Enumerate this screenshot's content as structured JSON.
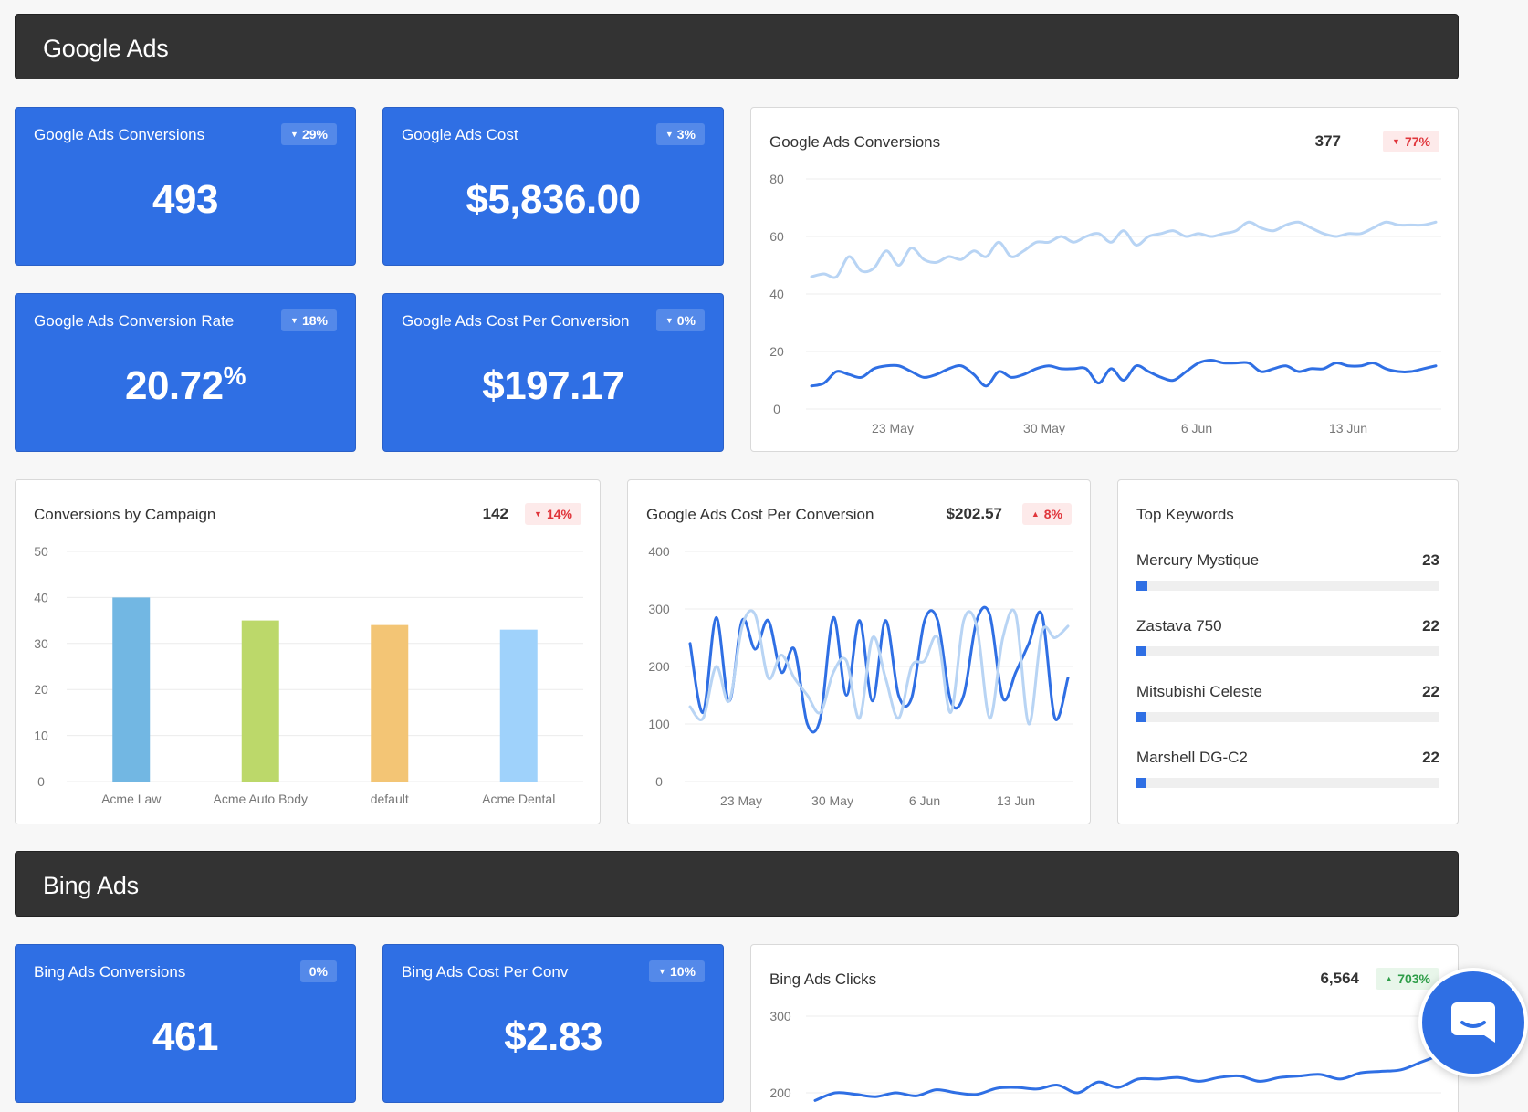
{
  "google_section": {
    "title": "Google Ads"
  },
  "bing_section": {
    "title": "Bing Ads"
  },
  "kpis": {
    "g_conversions": {
      "title": "Google Ads Conversions",
      "badge": "29%",
      "value": "493"
    },
    "g_cost": {
      "title": "Google Ads Cost",
      "badge": "3%",
      "value": "$5,836.00"
    },
    "g_conv_rate": {
      "title": "Google Ads Conversion Rate",
      "badge": "18%",
      "value": "20.72",
      "unit": "%"
    },
    "g_cost_per_conv": {
      "title": "Google Ads Cost Per Conversion",
      "badge": "0%",
      "value": "$197.17"
    },
    "b_conversions": {
      "title": "Bing Ads Conversions",
      "badge": "0%",
      "value": "461"
    },
    "b_cost_per_conv": {
      "title": "Bing Ads Cost Per Conv",
      "badge": "10%",
      "value": "$2.83"
    }
  },
  "cards": {
    "g_conv_chart": {
      "title": "Google Ads Conversions",
      "total": "377",
      "delta": "77%"
    },
    "campaign_chart": {
      "title": "Conversions by Campaign",
      "total": "142",
      "delta": "14%"
    },
    "cpc_chart": {
      "title": "Google Ads Cost Per Conversion",
      "total": "$202.57",
      "delta": "8%"
    },
    "keywords": {
      "title": "Top Keywords"
    },
    "bing_clicks": {
      "title": "Bing Ads Clicks",
      "total": "6,564",
      "delta": "703%"
    }
  },
  "keywords": [
    {
      "name": "Mercury Mystique",
      "count": "23",
      "fill": 0.035
    },
    {
      "name": "Zastava 750",
      "count": "22",
      "fill": 0.034
    },
    {
      "name": "Mitsubishi Celeste",
      "count": "22",
      "fill": 0.034
    },
    {
      "name": "Marshell DG-C2",
      "count": "22",
      "fill": 0.034
    }
  ],
  "colors": {
    "kpi_blue": "#2f6fe4",
    "series_dark": "#2f6fe4",
    "series_light": "#b8d4f4",
    "bar_colors": [
      "#72b7e3",
      "#bcd86a",
      "#f3c575",
      "#9fd2fb"
    ],
    "negative": "#e0353b",
    "positive": "#2e9d48"
  },
  "icons": {
    "badge_down": "triangle-down-icon",
    "badge_up": "triangle-up-icon",
    "chat": "chat-bubble-icon"
  },
  "tri_down": "▼",
  "tri_up": "▲",
  "chart_data": [
    {
      "id": "google_conversions",
      "type": "line",
      "x_ticks": [
        "23 May",
        "30 May",
        "6 Jun",
        "13 Jun"
      ],
      "y_ticks": [
        "0",
        "20",
        "40",
        "60",
        "80"
      ],
      "ylim": [
        0,
        80
      ],
      "series": [
        {
          "values": [
            46,
            47,
            46,
            53,
            48,
            49,
            55,
            50,
            56,
            52,
            51,
            53,
            52,
            55,
            53,
            58,
            53,
            55,
            58,
            58,
            60,
            58,
            60,
            61,
            58,
            62,
            57,
            60,
            61,
            62,
            60,
            61,
            60,
            61,
            62,
            65,
            63,
            62,
            64,
            65,
            63,
            61,
            60,
            61,
            61,
            63,
            65,
            64,
            64,
            64,
            65
          ]
        },
        {
          "values": [
            8,
            9,
            13,
            12,
            11,
            14,
            15,
            15,
            13,
            11,
            12,
            14,
            15,
            12,
            8,
            13,
            11,
            12,
            14,
            15,
            14,
            14,
            14,
            9,
            14,
            10,
            15,
            13,
            11,
            10,
            13,
            16,
            17,
            16,
            16,
            16,
            13,
            14,
            15,
            13,
            14,
            14,
            16,
            15,
            15,
            16,
            14,
            13,
            13,
            14,
            15
          ]
        }
      ]
    },
    {
      "id": "conversions_by_campaign",
      "type": "bar",
      "categories": [
        "Acme Law",
        "Acme Auto Body",
        "default",
        "Acme Dental"
      ],
      "values": [
        40,
        35,
        34,
        33
      ],
      "y_ticks": [
        "0",
        "10",
        "20",
        "30",
        "40",
        "50"
      ],
      "ylim": [
        0,
        50
      ]
    },
    {
      "id": "google_cost_per_conversion",
      "type": "line",
      "x_ticks": [
        "23 May",
        "30 May",
        "6 Jun",
        "13 Jun"
      ],
      "y_ticks": [
        "0",
        "100",
        "200",
        "300",
        "400"
      ],
      "ylim": [
        0,
        400
      ],
      "series": [
        {
          "values": [
            240,
            120,
            285,
            140,
            280,
            230,
            280,
            190,
            230,
            100,
            110,
            285,
            150,
            280,
            140,
            280,
            150,
            145,
            280,
            280,
            140,
            150,
            280,
            290,
            145,
            190,
            240,
            290,
            110,
            180
          ]
        },
        {
          "values": [
            130,
            110,
            200,
            140,
            270,
            290,
            180,
            220,
            180,
            150,
            120,
            190,
            210,
            110,
            250,
            180,
            110,
            200,
            210,
            250,
            120,
            280,
            270,
            110,
            250,
            290,
            100,
            260,
            250,
            270
          ]
        }
      ]
    },
    {
      "id": "bing_ads_clicks",
      "type": "line",
      "y_ticks": [
        "200",
        "300"
      ],
      "series": [
        {
          "values": [
            190,
            200,
            198,
            195,
            200,
            196,
            204,
            200,
            198,
            206,
            207,
            205,
            210,
            200,
            214,
            207,
            218,
            218,
            220,
            215,
            220,
            222,
            215,
            220,
            222,
            224,
            218,
            226,
            228,
            230,
            240,
            250
          ]
        }
      ]
    }
  ]
}
